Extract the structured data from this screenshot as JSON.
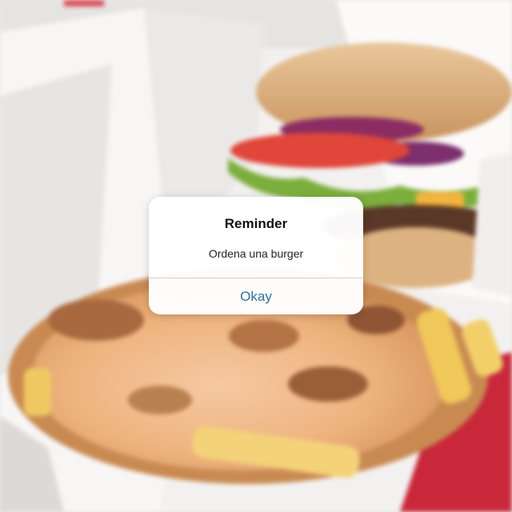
{
  "alert": {
    "title": "Reminder",
    "message": "Ordena una burger",
    "button_label": "Okay"
  },
  "colors": {
    "button_text": "#2f6f9f",
    "tray_red": "#c8283a"
  }
}
